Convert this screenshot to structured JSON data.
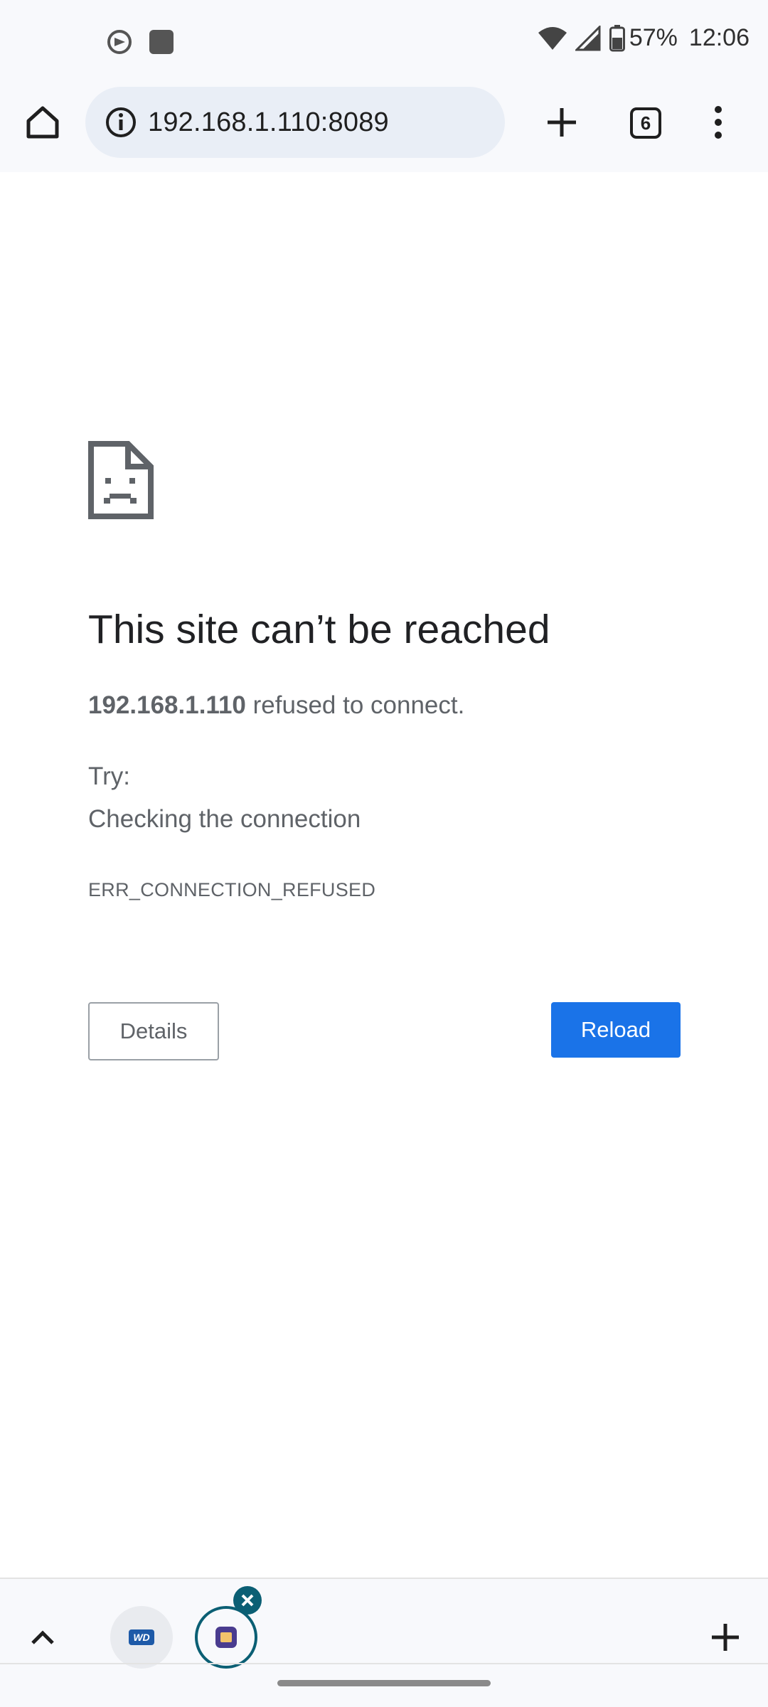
{
  "status_bar": {
    "battery_percent": "57%",
    "time": "12:06"
  },
  "toolbar": {
    "url": "192.168.1.110:8089",
    "tab_count": "6"
  },
  "error_page": {
    "title": "This site can’t be reached",
    "host": "192.168.1.110",
    "message": " refused to connect.",
    "try_label": "Try:",
    "suggestion": "Checking the connection",
    "error_code": "ERR_CONNECTION_REFUSED",
    "details_label": "Details",
    "reload_label": "Reload",
    "accent_color": "#1a73e8"
  },
  "tab_strip": {
    "thumb_1_logo": "WD",
    "icons": [
      "chevron-up-icon",
      "tab-thumbnail-wd",
      "tab-thumbnail-active",
      "close-icon",
      "plus-icon"
    ]
  }
}
